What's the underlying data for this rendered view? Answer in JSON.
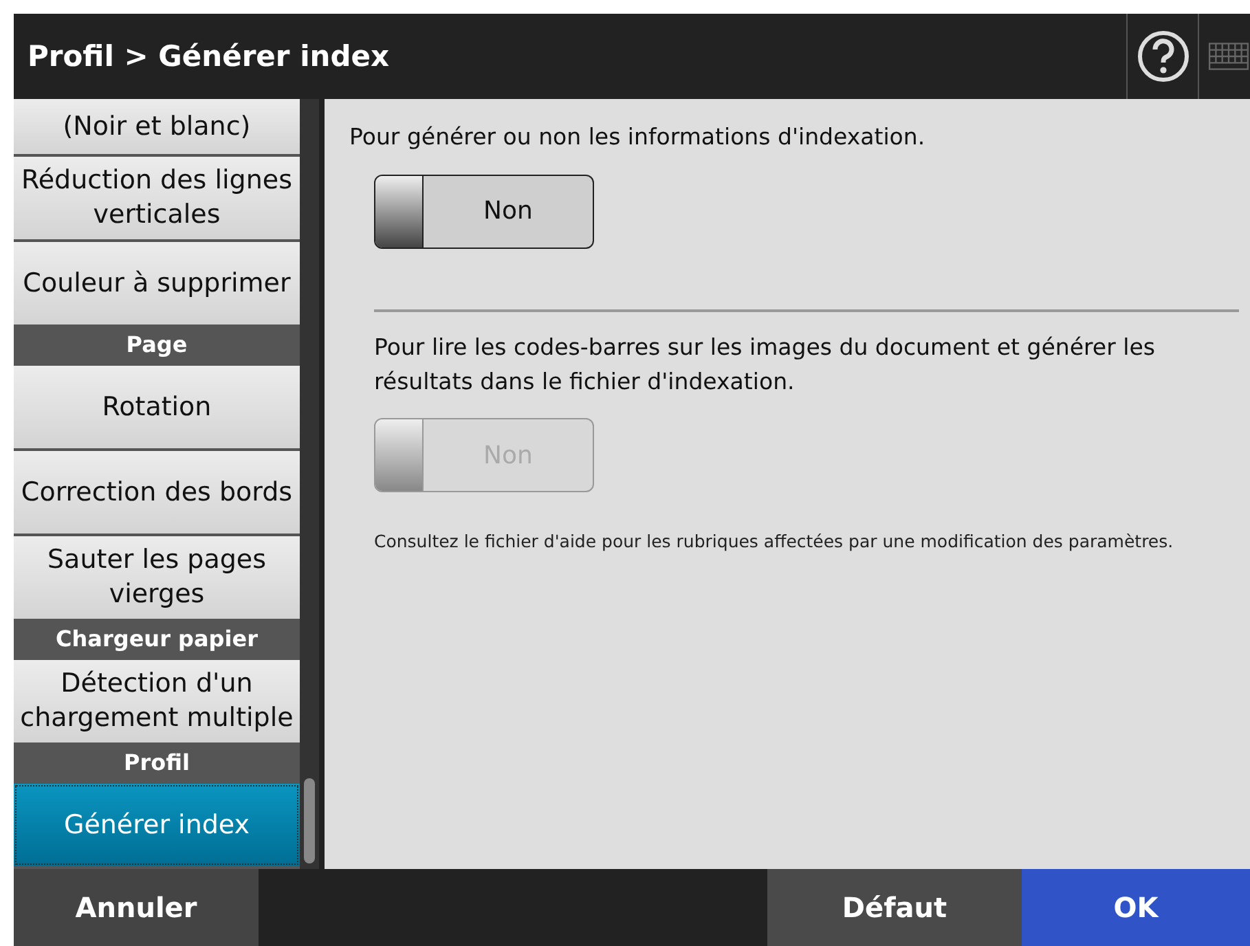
{
  "window": {
    "title": "Profil > Générer index"
  },
  "sidebar": {
    "items": [
      {
        "kind": "item",
        "label": "(Noir et blanc)",
        "selected": false
      },
      {
        "kind": "item",
        "label": "Réduction des lignes verticales",
        "selected": false
      },
      {
        "kind": "item",
        "label": "Couleur à supprimer",
        "selected": false
      },
      {
        "kind": "header",
        "label": "Page"
      },
      {
        "kind": "item",
        "label": "Rotation",
        "selected": false
      },
      {
        "kind": "item",
        "label": "Correction des bords",
        "selected": false
      },
      {
        "kind": "item",
        "label": "Sauter les pages vierges",
        "selected": false
      },
      {
        "kind": "header",
        "label": "Chargeur papier"
      },
      {
        "kind": "item",
        "label": "Détection d'un chargement multiple",
        "selected": false
      },
      {
        "kind": "header",
        "label": "Profil"
      },
      {
        "kind": "item",
        "label": "Générer index",
        "selected": true
      }
    ]
  },
  "settings": [
    {
      "description": "Pour générer ou non les informations d'indexation.",
      "toggle": {
        "label": "Non",
        "on": false,
        "disabled": false
      }
    },
    {
      "description": "Pour lire les codes-barres sur les images du document et générer les résultats dans le fichier d'indexation.",
      "toggle": {
        "label": "Non",
        "on": false,
        "disabled": true
      }
    }
  ],
  "note": "Consultez le fichier d'aide pour les rubriques affectées par une modification des paramètres.",
  "buttons": [
    {
      "kind": "cancel",
      "label": "Annuler"
    },
    {
      "kind": "default",
      "label": "Défaut"
    },
    {
      "kind": "ok",
      "label": "OK"
    }
  ]
}
